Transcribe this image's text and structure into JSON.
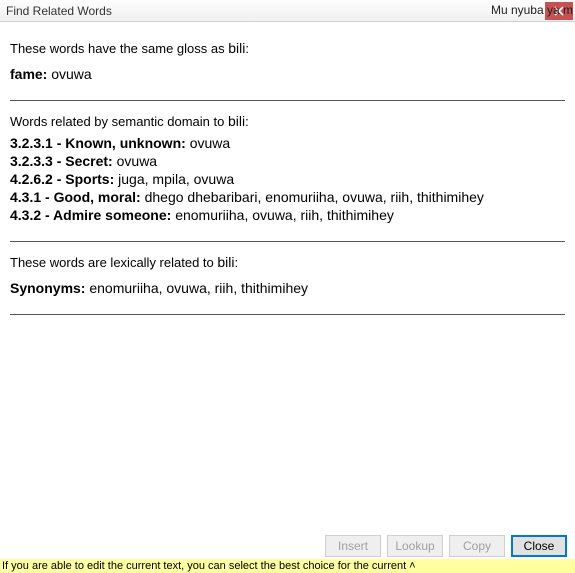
{
  "window": {
    "title": "Find Related Words"
  },
  "sections": {
    "same_gloss": {
      "intro_prefix": "These words have the same gloss as ",
      "target_word": "bili",
      "entries": [
        {
          "label": "fame:",
          "words": "ovuwa"
        }
      ]
    },
    "semantic_domain": {
      "intro_prefix": "Words related by semantic domain to ",
      "target_word": "bili",
      "entries": [
        {
          "label": "3.2.3.1 - Known, unknown:",
          "words": "ovuwa"
        },
        {
          "label": "3.2.3.3 - Secret:",
          "words": "ovuwa"
        },
        {
          "label": "4.2.6.2 - Sports:",
          "words": "juga, mpila, ovuwa"
        },
        {
          "label": "4.3.1 - Good, moral:",
          "words": "dhego dhebaribari, enomuriiha, ovuwa, riih, thithimihey"
        },
        {
          "label": "4.3.2 - Admire someone:",
          "words": "enomuriiha, ovuwa, riih, thithimihey"
        }
      ]
    },
    "lexical": {
      "intro_prefix": "These words are lexically related to ",
      "target_word": "bili",
      "entries": [
        {
          "label": "Synonyms:",
          "words": "enomuriiha, ovuwa, riih, thithimihey"
        }
      ]
    }
  },
  "buttons": {
    "insert": "Insert",
    "lookup": "Lookup",
    "copy": "Copy",
    "close": "Close"
  },
  "status": {
    "text": "If you are able to edit the current text, you can select the best choice for the current"
  },
  "background": {
    "top_line": "Mu nyuba ya m"
  }
}
